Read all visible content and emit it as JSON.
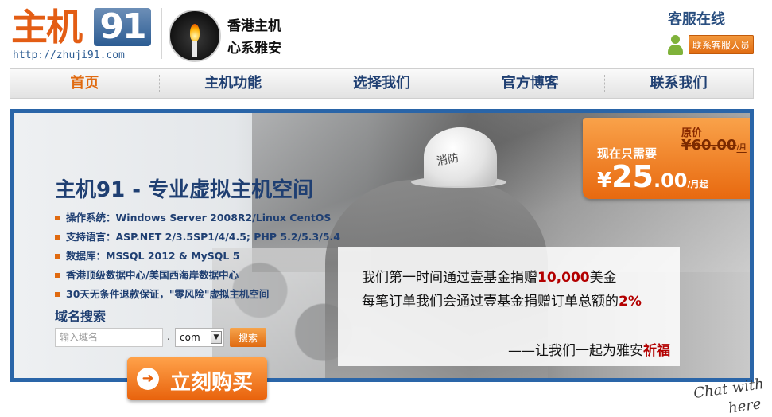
{
  "logo": {
    "text": "主机",
    "number": "91",
    "url": "http://zhuji91.com"
  },
  "header": {
    "tagline_line1": "香港主机",
    "tagline_line2": "心系雅安"
  },
  "support": {
    "title": "客服在线",
    "button": "联系客服人员"
  },
  "nav": [
    {
      "label": "首页",
      "active": true
    },
    {
      "label": "主机功能",
      "active": false
    },
    {
      "label": "选择我们",
      "active": false
    },
    {
      "label": "官方博客",
      "active": false
    },
    {
      "label": "联系我们",
      "active": false
    }
  ],
  "banner": {
    "title": "主机91 - 专业虚拟主机空间",
    "features": [
      "操作系统：Windows Server 2008R2/Linux CentOS",
      "支持语言：ASP.NET 2/3.5SP1/4/4.5; PHP 5.2/5.3/5.4",
      "数据库：MSSQL 2012 & MySQL 5",
      "香港顶级数据中心/美国西海岸数据中心",
      "30天无条件退款保证，\"零风险\"虚拟主机空间"
    ],
    "helmet_text": "消防"
  },
  "domain_search": {
    "label": "域名搜索",
    "placeholder": "输入域名",
    "dot": ".",
    "tld": "com",
    "button": "搜索"
  },
  "price": {
    "original_label": "原价",
    "original": "¥60.00",
    "original_unit": "/月",
    "now_label": "现在只需要",
    "now_currency": "¥",
    "now_int": "25",
    "now_dec": ".00",
    "now_unit": "/月起"
  },
  "donation": {
    "line1_pre": "我们第一时间通过壹基金捐赠",
    "line1_amount": "10,000",
    "line1_post": "美金",
    "line2_pre": "每笔订单我们会通过壹基金捐赠订单总额的",
    "line2_pct": "2%",
    "sign_pre": "——让我们一起为雅安",
    "sign_bless": "祈福"
  },
  "buy": {
    "label": "立刻购买"
  },
  "chat": {
    "line1": "Chat with",
    "line2": "here"
  },
  "colors": {
    "brand_orange": "#e06a10",
    "brand_blue": "#2a65a8",
    "nav_text": "#1f3f72",
    "highlight_red": "#b30000"
  }
}
